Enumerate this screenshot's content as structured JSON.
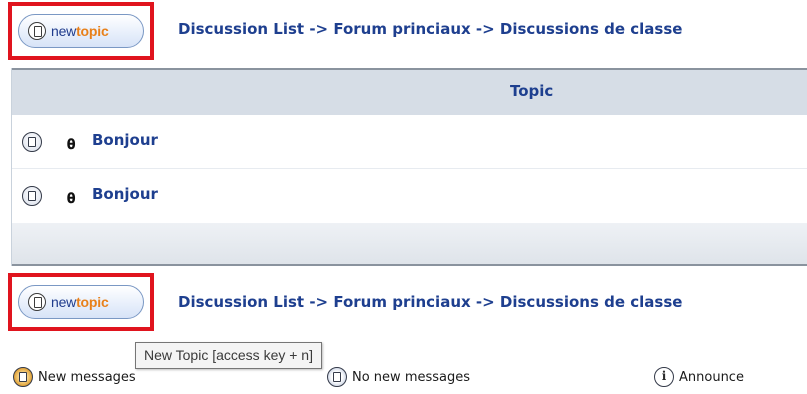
{
  "top_bar": {
    "new_topic": {
      "new": "new",
      "topic": "topic"
    },
    "breadcrumb": "Discussion List -> Forum princiaux -> Discussions de classe"
  },
  "table": {
    "header": "Topic",
    "rows": [
      {
        "title": "Bonjour",
        "attachment_icon": "paperclip-icon",
        "status_icon": "no-new-messages-icon"
      },
      {
        "title": "Bonjour",
        "attachment_icon": "paperclip-icon",
        "status_icon": "no-new-messages-icon"
      }
    ]
  },
  "bottom_bar": {
    "new_topic": {
      "new": "new",
      "topic": "topic"
    },
    "breadcrumb": "Discussion List -> Forum princiaux -> Discussions de classe"
  },
  "tooltip": "New Topic [access key + n]",
  "legend": [
    {
      "icon": "new-messages-icon",
      "label": "New messages"
    },
    {
      "icon": "no-new-messages-icon",
      "label": "No new messages"
    },
    {
      "icon": "announce-icon",
      "label": "Announce",
      "glyph": "i"
    }
  ],
  "colors": {
    "highlight": "#e0141e",
    "link": "#1e3f8f",
    "topic_orange": "#e8801a",
    "header_bg": "#d6dde6"
  }
}
